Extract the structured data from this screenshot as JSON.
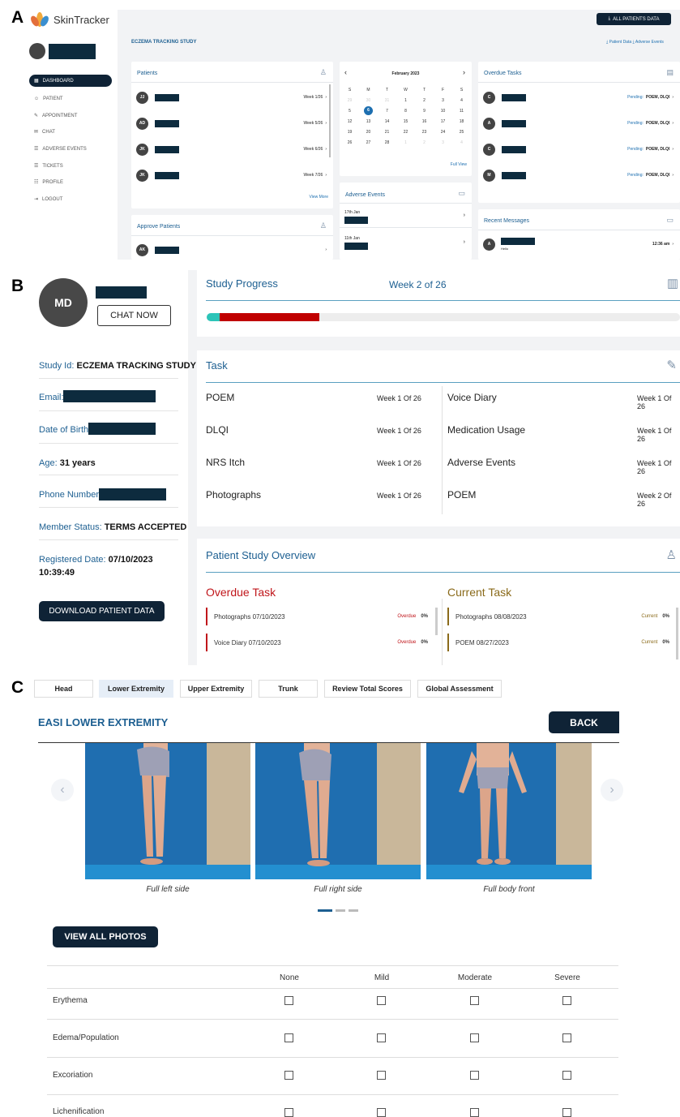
{
  "labels": {
    "a": "A",
    "b": "B",
    "c": "C"
  },
  "panelA": {
    "brand": "SkinTracker",
    "nav": [
      "DASHBOARD",
      "PATIENT",
      "APPOINTMENT",
      "CHAT",
      "ADVERSE EVENTS",
      "TICKETS",
      "PROFILE",
      "LOGOUT"
    ],
    "export_button": "ALL PATIENTS DATA",
    "study_title": "ECZEMA TRACKING STUDY",
    "links": {
      "patient_data": "Patient Data",
      "adverse_events": "Adverse Events"
    },
    "patients": {
      "title": "Patients",
      "rows": [
        {
          "initials": "JJ",
          "week": "Week 1/26"
        },
        {
          "initials": "AD",
          "week": "Week 5/26"
        },
        {
          "initials": "JK",
          "week": "Week 6/26"
        },
        {
          "initials": "JK",
          "week": "Week 7/26"
        }
      ],
      "more": "View More"
    },
    "approve": {
      "title": "Approve Patients",
      "rows": [
        {
          "initials": "AK"
        }
      ]
    },
    "calendar": {
      "month": "February 2023",
      "days": [
        "S",
        "M",
        "T",
        "W",
        "T",
        "F",
        "S"
      ],
      "weeks": [
        [
          "29",
          "30",
          "31",
          "1",
          "2",
          "3",
          "4"
        ],
        [
          "5",
          "6",
          "7",
          "8",
          "9",
          "10",
          "11"
        ],
        [
          "12",
          "13",
          "14",
          "15",
          "16",
          "17",
          "18"
        ],
        [
          "19",
          "20",
          "21",
          "22",
          "23",
          "24",
          "25"
        ],
        [
          "26",
          "27",
          "28",
          "1",
          "2",
          "3",
          "4"
        ]
      ],
      "full_view": "Full View"
    },
    "adverse": {
      "title": "Adverse Events",
      "rows": [
        {
          "date": "17th Jan"
        },
        {
          "date": "11th Jan"
        }
      ]
    },
    "overdue": {
      "title": "Overdue Tasks",
      "rows": [
        {
          "initials": "C",
          "pending": "Pending:",
          "tasks": "POEM, DLQI"
        },
        {
          "initials": "A",
          "pending": "Pending:",
          "tasks": "POEM, DLQI"
        },
        {
          "initials": "C",
          "pending": "Pending:",
          "tasks": "POEM, DLQI"
        },
        {
          "initials": "M",
          "pending": "Pending:",
          "tasks": "POEM, DLQI"
        }
      ]
    },
    "messages": {
      "title": "Recent Messages",
      "rows": [
        {
          "initials": "A",
          "text": "Hello",
          "time": "12:36 am"
        }
      ]
    }
  },
  "panelB": {
    "initials": "MD",
    "chat": "CHAT NOW",
    "fields": [
      {
        "label": "Study Id:",
        "value": "ECZEMA TRACKING STUDY"
      },
      {
        "label": "Email:",
        "value": ""
      },
      {
        "label": "Date of Birth:",
        "value": ""
      },
      {
        "label": "Age:",
        "value": "31 years"
      },
      {
        "label": "Phone Number:",
        "value": ""
      },
      {
        "label": "Member Status:",
        "value": "TERMS ACCEPTED"
      },
      {
        "label": "Registered Date:",
        "value": "07/10/2023"
      },
      {
        "label": "",
        "value": "10:39:49"
      }
    ],
    "download": "DOWNLOAD PATIENT DATA",
    "progress": {
      "title": "Study Progress",
      "week": "Week 2 of 26",
      "segments": [
        {
          "fraction": 0.028,
          "color": "#2cc4b8"
        },
        {
          "fraction": 0.21,
          "color": "#c00000"
        }
      ]
    },
    "task": {
      "title": "Task",
      "left": [
        {
          "name": "POEM",
          "week": "Week 1 Of 26"
        },
        {
          "name": "DLQI",
          "week": "Week 1 Of 26"
        },
        {
          "name": "NRS Itch",
          "week": "Week 1 Of 26"
        },
        {
          "name": "Photographs",
          "week": "Week 1 Of 26"
        }
      ],
      "right": [
        {
          "name": "Voice Diary",
          "week": "Week 1 Of 26"
        },
        {
          "name": "Medication Usage",
          "week": "Week 1 Of 26"
        },
        {
          "name": "Adverse Events",
          "week": "Week 1 Of 26"
        },
        {
          "name": "POEM",
          "week": "Week 2 Of 26"
        }
      ]
    },
    "overview": {
      "title": "Patient Study Overview",
      "overdue_title": "Overdue Task",
      "overdue": [
        {
          "name": "Photographs 07/10/2023",
          "status": "Overdue",
          "pct": "0%"
        },
        {
          "name": "Voice Diary 07/10/2023",
          "status": "Overdue",
          "pct": "0%"
        }
      ],
      "current_title": "Current Task",
      "current": [
        {
          "name": "Photographs 08/08/2023",
          "status": "Current",
          "pct": "0%"
        },
        {
          "name": "POEM 08/27/2023",
          "status": "Current",
          "pct": "0%"
        }
      ]
    }
  },
  "panelC": {
    "tabs": [
      "Head",
      "Lower Extremity",
      "Upper Extremity",
      "Trunk",
      "Review Total Scores",
      "Global Assessment"
    ],
    "active_tab": "Lower Extremity",
    "title": "EASI LOWER EXTREMITY",
    "back": "BACK",
    "captions": [
      "Full left side",
      "Full right side",
      "Full body front"
    ],
    "view_all": "VIEW ALL PHOTOS",
    "columns": [
      "None",
      "Mild",
      "Moderate",
      "Severe"
    ],
    "rows": [
      "Erythema",
      "Edema/Population",
      "Excoriation",
      "Lichenification"
    ]
  }
}
